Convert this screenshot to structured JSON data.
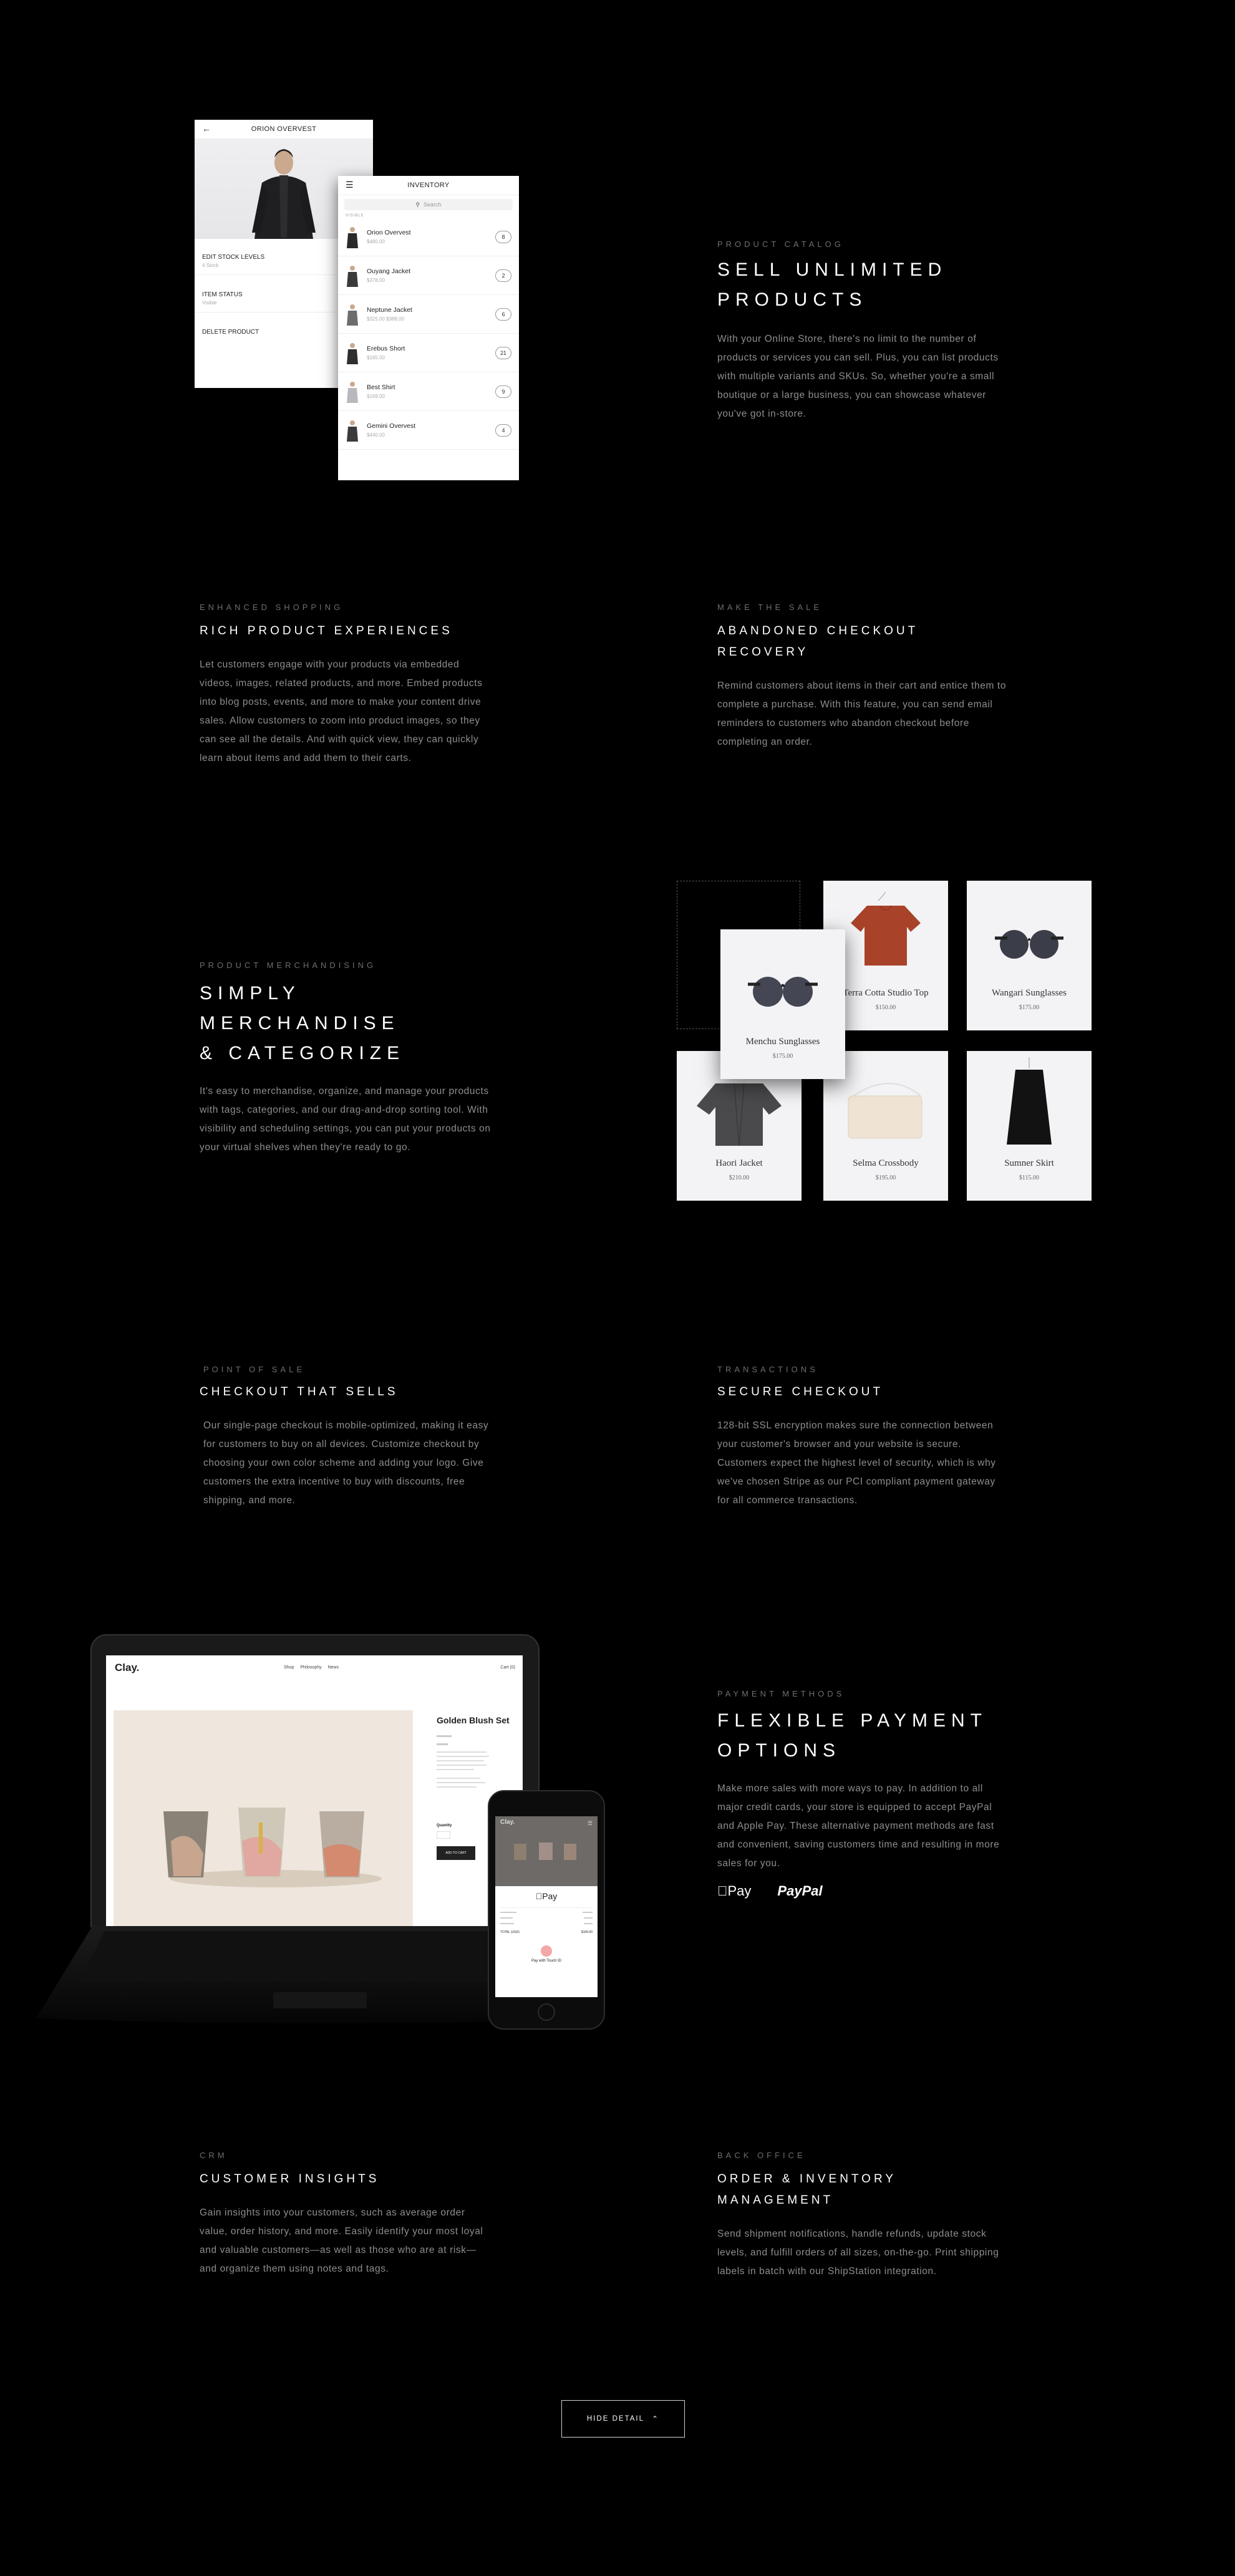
{
  "catalog": {
    "eyebrow": "PRODUCT CATALOG",
    "title_l1": "SELL UNLIMITED",
    "title_l2": "PRODUCTS",
    "body": "With your Online Store, there's no limit to the number of products or services you can sell. Plus, you can list products with multiple variants and SKUs. So, whether you're a small boutique or a large business, you can showcase whatever you've got in-store."
  },
  "detail_screen": {
    "title": "ORION OVERVEST",
    "rows": [
      {
        "label": "EDIT STOCK LEVELS",
        "sub": "4 Stock"
      },
      {
        "label": "ITEM STATUS",
        "sub": "Visible"
      },
      {
        "label": "DELETE PRODUCT",
        "sub": ""
      }
    ]
  },
  "inventory_screen": {
    "title": "INVENTORY",
    "search_placeholder": "Search",
    "section": "VISIBLE",
    "items": [
      {
        "name": "Orion Overvest",
        "price": "$480.00",
        "count": "8"
      },
      {
        "name": "Ouyang Jacket",
        "price": "$378.00",
        "count": "2"
      },
      {
        "name": "Neptune Jacket",
        "price": "$325.00 $388.00",
        "count": "6"
      },
      {
        "name": "Erebus Short",
        "price": "$165.00",
        "count": "21"
      },
      {
        "name": "Best Shirt",
        "price": "$169.00",
        "count": "9"
      },
      {
        "name": "Gemini Overvest",
        "price": "$440.00",
        "count": "4"
      }
    ]
  },
  "rich": {
    "eyebrow": "ENHANCED SHOPPING",
    "title": "RICH PRODUCT EXPERIENCES",
    "body": "Let customers engage with your products via embedded videos, images, related products, and more. Embed products into blog posts, events, and more to make your content drive sales. Allow customers to zoom into product images, so they can see all the details. And with quick view, they can quickly learn about items and add them to their carts."
  },
  "abandoned": {
    "eyebrow": "MAKE THE SALE",
    "title_l1": "ABANDONED CHECKOUT",
    "title_l2": "RECOVERY",
    "body": "Remind customers about items in their cart and entice them to complete a purchase. With this feature, you can send email reminders to customers who abandon checkout before completing an order."
  },
  "merch": {
    "eyebrow": "PRODUCT MERCHANDISING",
    "title_l1": "SIMPLY MERCHANDISE",
    "title_l2": "& CATEGORIZE",
    "body": "It's easy to merchandise, organize, and manage your products with tags, categories, and our drag-and-drop sorting tool. With visibility and scheduling settings, you can put your products on your virtual shelves when they're ready to go.",
    "tiles": [
      {
        "name": "Terra Cotta Studio Top",
        "price": "$150.00"
      },
      {
        "name": "Wangari Sunglasses",
        "price": "$175.00"
      },
      {
        "name": "Menchu Sunglasses",
        "price": "$175.00"
      },
      {
        "name": "Haori Jacket",
        "price": "$210.00"
      },
      {
        "name": "Selma Crossbody",
        "price": "$195.00"
      },
      {
        "name": "Sumner Skirt",
        "price": "$115.00"
      }
    ]
  },
  "pos": {
    "eyebrow": "POINT OF SALE",
    "title": "CHECKOUT THAT SELLS",
    "body": "Our single-page checkout is mobile-optimized, making it easy for customers to buy on all devices. Customize checkout by choosing your own color scheme and adding your logo. Give customers the extra incentive to buy with discounts, free shipping, and more."
  },
  "secure": {
    "eyebrow": "TRANSACTIONS",
    "title": "SECURE CHECKOUT",
    "body": "128-bit SSL encryption makes sure the connection between your customer's browser and your website is secure. Customers expect the highest level of security, which is why we've chosen Stripe as our PCI compliant payment gateway for all commerce transactions."
  },
  "laptop_site": {
    "logo": "Clay.",
    "nav": [
      "Shop",
      "Philosophy",
      "News"
    ],
    "cart": "Cart (0)",
    "product_title": "Golden Blush Set",
    "add_button": "ADD TO CART",
    "quantity_label": "Quantity"
  },
  "phone": {
    "logo": "Clay.",
    "pay_label": "Pay",
    "total_label": "TOTAL (USD)",
    "total": "$100.00",
    "touch_id": "Pay with Touch ID"
  },
  "payment": {
    "eyebrow": "PAYMENT METHODS",
    "title_l1": "FLEXIBLE PAYMENT",
    "title_l2": "OPTIONS",
    "body": "Make more sales with more ways to pay. In addition to all major credit cards, your store is equipped to accept PayPal and Apple Pay. These alternative payment methods are fast and convenient, saving customers time and resulting in more sales for you.",
    "applepay": "Pay",
    "paypal": "PayPal"
  },
  "crm": {
    "eyebrow": "CRM",
    "title": "CUSTOMER INSIGHTS",
    "body": "Gain insights into your customers, such as average order value, order history, and more. Easily identify your most loyal and valuable customers—as well as those who are at risk—and organize them using notes and tags."
  },
  "backoffice": {
    "eyebrow": "BACK OFFICE",
    "title_l1": "ORDER & INVENTORY",
    "title_l2": "MANAGEMENT",
    "body": "Send shipment notifications, handle refunds, update stock levels, and fulfill orders of all sizes, on-the-go. Print shipping labels in batch with our ShipStation integration."
  },
  "hide_button": {
    "label": "HIDE DETAIL",
    "icon": "chevron-up-icon"
  },
  "colors": {
    "background": "#000000",
    "text": "#ffffff",
    "muted": "#8e8e8e",
    "eyebrow": "#6e6e6e"
  }
}
